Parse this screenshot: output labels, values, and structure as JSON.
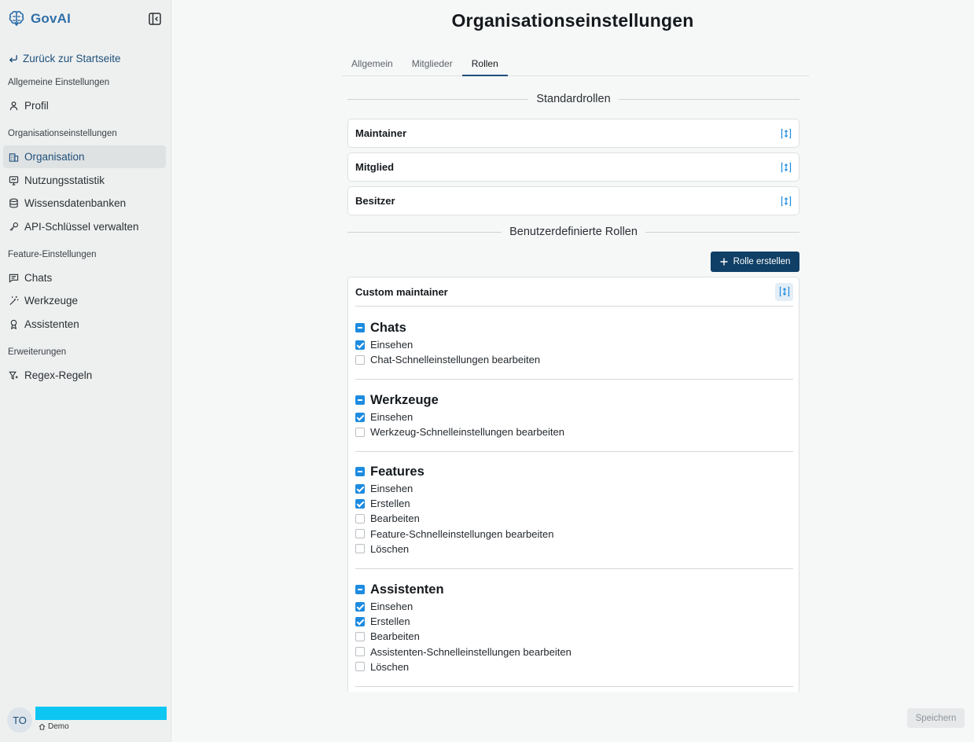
{
  "app": {
    "name": "GovAI"
  },
  "sidebar": {
    "back_label": "Zurück zur Startseite",
    "sections": {
      "general": "Allgemeine Einstellungen",
      "organisation": "Organisationseinstellungen",
      "features": "Feature-Einstellungen",
      "extensions": "Erweiterungen"
    },
    "items": {
      "profile": "Profil",
      "organisation": "Organisation",
      "usage": "Nutzungsstatistik",
      "knowledge": "Wissensdatenbanken",
      "api_keys": "API-Schlüssel verwalten",
      "chats": "Chats",
      "tools": "Werkzeuge",
      "assistants": "Assistenten",
      "regex": "Regex-Regeln"
    },
    "user": {
      "initials": "TO",
      "org": "Demo"
    }
  },
  "page": {
    "title": "Organisationseinstellungen",
    "tabs": [
      "Allgemein",
      "Mitglieder",
      "Rollen"
    ],
    "active_tab": "Rollen"
  },
  "standard_roles": {
    "heading": "Standardrollen",
    "roles": [
      "Maintainer",
      "Mitglied",
      "Besitzer"
    ]
  },
  "custom_roles": {
    "heading": "Benutzerdefinierte Rollen",
    "create_label": "Rolle erstellen",
    "role": {
      "name": "Custom maintainer",
      "groups": [
        {
          "title": "Chats",
          "permissions": [
            {
              "label": "Einsehen",
              "checked": true
            },
            {
              "label": "Chat-Schnelleinstellungen bearbeiten",
              "checked": false
            }
          ]
        },
        {
          "title": "Werkzeuge",
          "permissions": [
            {
              "label": "Einsehen",
              "checked": true
            },
            {
              "label": "Werkzeug-Schnelleinstellungen bearbeiten",
              "checked": false
            }
          ]
        },
        {
          "title": "Features",
          "permissions": [
            {
              "label": "Einsehen",
              "checked": true
            },
            {
              "label": "Erstellen",
              "checked": true
            },
            {
              "label": "Bearbeiten",
              "checked": false
            },
            {
              "label": "Feature-Schnelleinstellungen bearbeiten",
              "checked": false
            },
            {
              "label": "Löschen",
              "checked": false
            }
          ]
        },
        {
          "title": "Assistenten",
          "permissions": [
            {
              "label": "Einsehen",
              "checked": true
            },
            {
              "label": "Erstellen",
              "checked": true
            },
            {
              "label": "Bearbeiten",
              "checked": false
            },
            {
              "label": "Assistenten-Schnelleinstellungen bearbeiten",
              "checked": false
            },
            {
              "label": "Löschen",
              "checked": false
            }
          ]
        }
      ]
    }
  },
  "footer": {
    "save_label": "Speichern"
  },
  "colors": {
    "brand": "#2f6fa8",
    "primary": "#0f3f66",
    "accent": "#1d8be0"
  },
  "icons": {
    "logo": "brain-logo-icon",
    "collapse": "sidebar-collapse-icon",
    "back": "return-arrow-icon",
    "expand": "expand-vertical-icon",
    "add": "plus-icon"
  }
}
